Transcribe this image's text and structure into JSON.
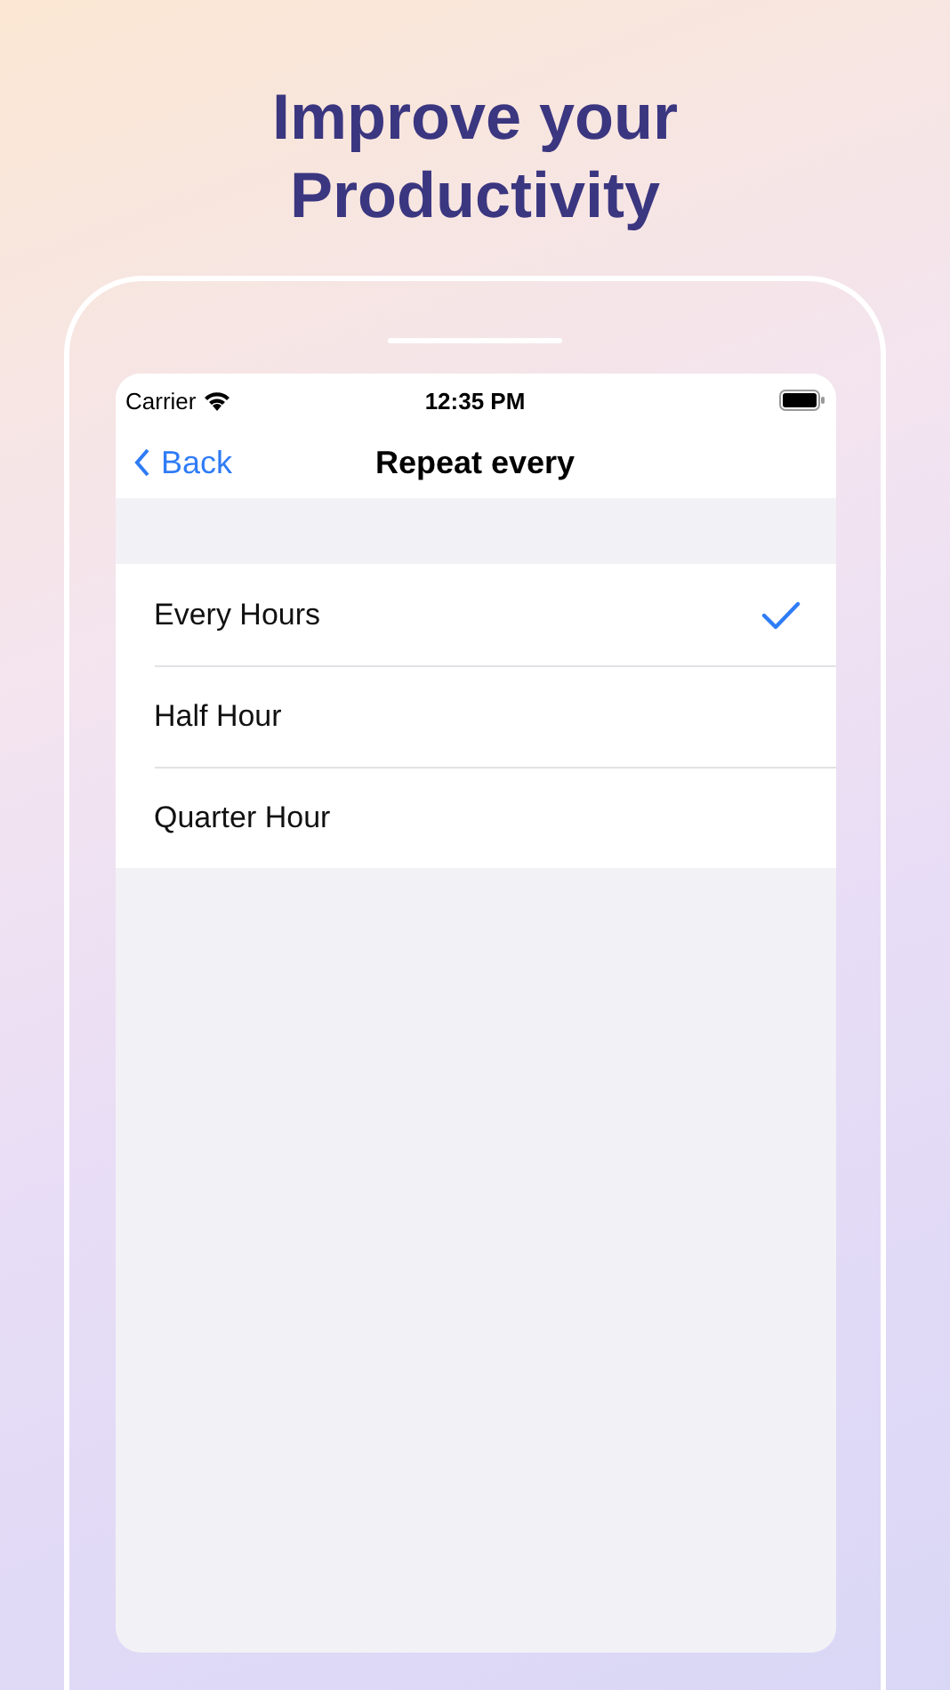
{
  "headline": [
    "Improve your",
    "Productivity"
  ],
  "status_bar": {
    "carrier": "Carrier",
    "time": "12:35 PM"
  },
  "nav_bar": {
    "back": "Back",
    "title": "Repeat every"
  },
  "options": [
    {
      "label": "Every Hours",
      "selected": true
    },
    {
      "label": "Half Hour",
      "selected": false
    },
    {
      "label": "Quarter Hour",
      "selected": false
    }
  ]
}
